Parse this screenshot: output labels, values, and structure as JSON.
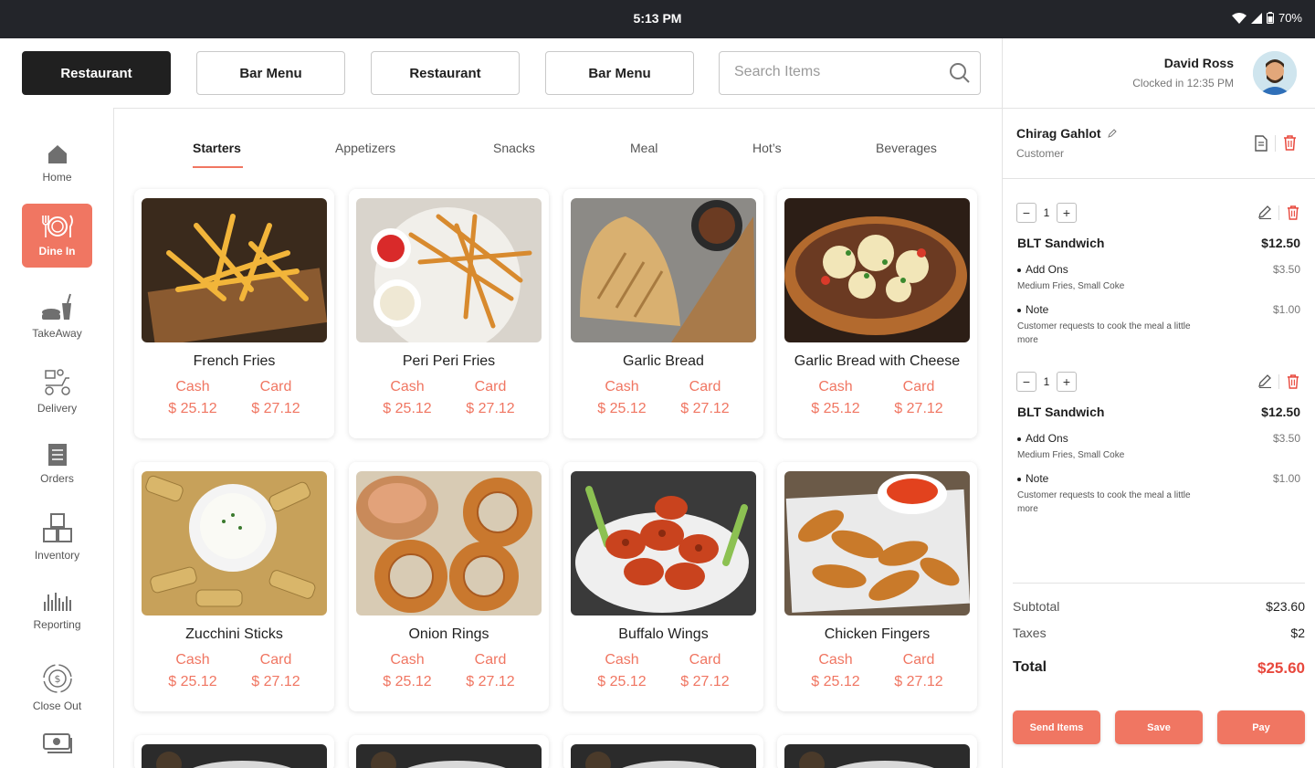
{
  "status_bar": {
    "time": "5:13 PM",
    "battery": "70%"
  },
  "top_bar": {
    "buttons": [
      "Restaurant",
      "Bar Menu",
      "Restaurant",
      "Bar Menu"
    ],
    "search_placeholder": "Search Items"
  },
  "sidebar": {
    "items": [
      {
        "label": "Home",
        "icon": "home-icon"
      },
      {
        "label": "Dine In",
        "icon": "dine-in-icon",
        "active": true
      },
      {
        "label": "TakeAway",
        "icon": "takeaway-icon"
      },
      {
        "label": "Delivery",
        "icon": "delivery-icon"
      },
      {
        "label": "Orders",
        "icon": "orders-icon"
      },
      {
        "label": "Inventory",
        "icon": "inventory-icon"
      },
      {
        "label": "Reporting",
        "icon": "reporting-icon"
      },
      {
        "label": "Close Out",
        "icon": "close-out-icon"
      }
    ]
  },
  "categories": [
    "Starters",
    "Appetizers",
    "Snacks",
    "Meal",
    "Hot’s",
    "Beverages"
  ],
  "products": [
    {
      "name": "French Fries",
      "cash_label": "Cash",
      "card_label": "Card",
      "cash": "$ 25.12",
      "card": "$ 27.12"
    },
    {
      "name": "Peri Peri Fries",
      "cash_label": "Cash",
      "card_label": "Card",
      "cash": "$ 25.12",
      "card": "$ 27.12"
    },
    {
      "name": "Garlic Bread",
      "cash_label": "Cash",
      "card_label": "Card",
      "cash": "$ 25.12",
      "card": "$ 27.12"
    },
    {
      "name": "Garlic Bread with Cheese",
      "cash_label": "Cash",
      "card_label": "Card",
      "cash": "$ 25.12",
      "card": "$ 27.12"
    },
    {
      "name": "Zucchini Sticks",
      "cash_label": "Cash",
      "card_label": "Card",
      "cash": "$ 25.12",
      "card": "$ 27.12"
    },
    {
      "name": "Onion Rings",
      "cash_label": "Cash",
      "card_label": "Card",
      "cash": "$ 25.12",
      "card": "$ 27.12"
    },
    {
      "name": "Buffalo Wings",
      "cash_label": "Cash",
      "card_label": "Card",
      "cash": "$ 25.12",
      "card": "$ 27.12"
    },
    {
      "name": "Chicken Fingers",
      "cash_label": "Cash",
      "card_label": "Card",
      "cash": "$ 25.12",
      "card": "$ 27.12"
    }
  ],
  "user": {
    "name": "David Ross",
    "clocked": "Clocked in 12:35 PM"
  },
  "customer": {
    "name": "Chirag Gahlot",
    "role": "Customer"
  },
  "order_items": [
    {
      "qty": "1",
      "name": "BLT Sandwich",
      "price": "$12.50",
      "addons_label": "Add Ons",
      "addons_price": "$3.50",
      "addons_desc": "Medium Fries, Small Coke",
      "note_label": "Note",
      "note_price": "$1.00",
      "note_desc": "Customer requests to cook the meal a little more"
    },
    {
      "qty": "1",
      "name": "BLT Sandwich",
      "price": "$12.50",
      "addons_label": "Add Ons",
      "addons_price": "$3.50",
      "addons_desc": "Medium Fries, Small Coke",
      "note_label": "Note",
      "note_price": "$1.00",
      "note_desc": "Customer requests to cook the meal a little more"
    }
  ],
  "totals": {
    "subtotal_label": "Subtotal",
    "subtotal": "$23.60",
    "taxes_label": "Taxes",
    "taxes": "$2",
    "total_label": "Total",
    "total": "$25.60"
  },
  "actions": {
    "send": "Send Items",
    "save": "Save",
    "pay": "Pay"
  },
  "colors": {
    "accent": "#f07662",
    "dark": "#202020",
    "danger": "#e8483d"
  }
}
